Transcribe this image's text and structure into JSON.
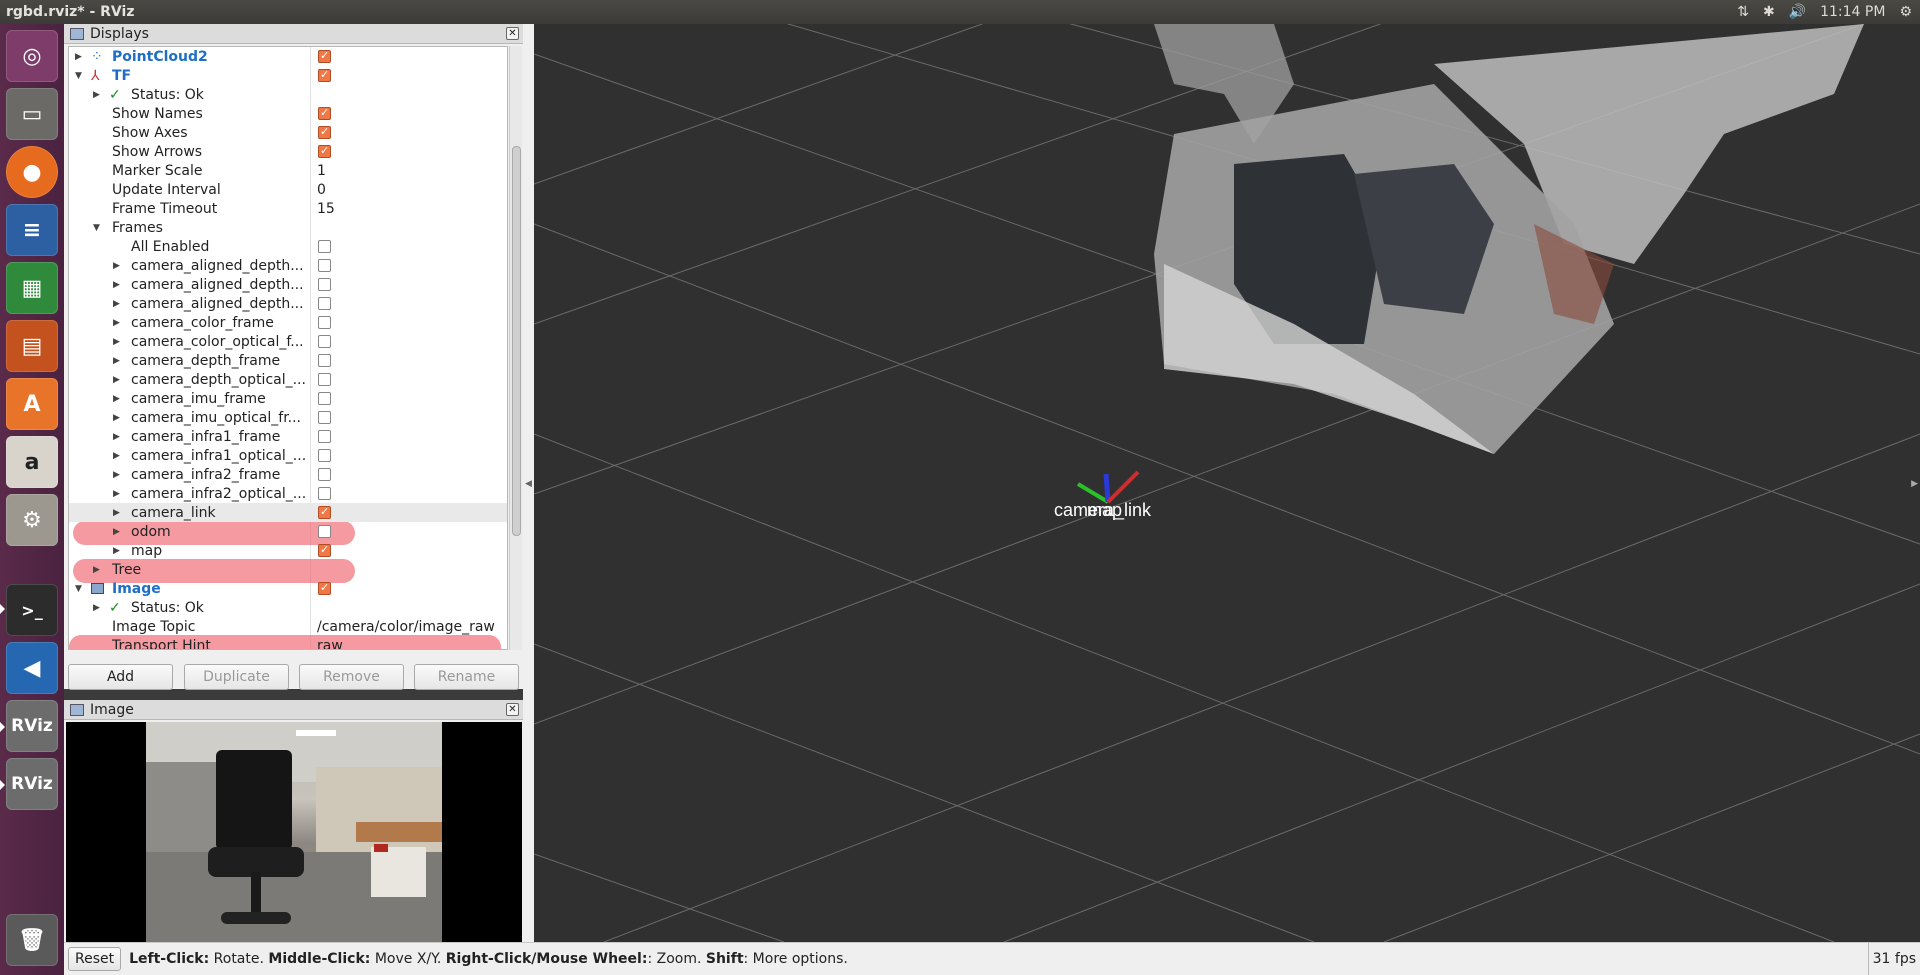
{
  "window": {
    "title": "rgbd.rviz* - RViz"
  },
  "indicators": {
    "time": "11:14 PM"
  },
  "displays_panel": {
    "title": "Displays",
    "rows": [
      {
        "label": "PointCloud2"
      },
      {
        "label": "TF"
      },
      {
        "label": "Status: Ok"
      },
      {
        "label": "Show Names"
      },
      {
        "label": "Show Axes"
      },
      {
        "label": "Show Arrows"
      },
      {
        "label": "Marker Scale",
        "value": "1"
      },
      {
        "label": "Update Interval",
        "value": "0"
      },
      {
        "label": "Frame Timeout",
        "value": "15"
      },
      {
        "label": "Frames"
      },
      {
        "label": "All Enabled"
      },
      {
        "label": "camera_aligned_depth..."
      },
      {
        "label": "camera_aligned_depth..."
      },
      {
        "label": "camera_aligned_depth..."
      },
      {
        "label": "camera_color_frame"
      },
      {
        "label": "camera_color_optical_f..."
      },
      {
        "label": "camera_depth_frame"
      },
      {
        "label": "camera_depth_optical_..."
      },
      {
        "label": "camera_imu_frame"
      },
      {
        "label": "camera_imu_optical_fr..."
      },
      {
        "label": "camera_infra1_frame"
      },
      {
        "label": "camera_infra1_optical_..."
      },
      {
        "label": "camera_infra2_frame"
      },
      {
        "label": "camera_infra2_optical_..."
      },
      {
        "label": "camera_link"
      },
      {
        "label": "odom"
      },
      {
        "label": "map"
      },
      {
        "label": "Tree"
      },
      {
        "label": "Image"
      },
      {
        "label": "Status: Ok"
      },
      {
        "label": "Image Topic",
        "value": "/camera/color/image_raw"
      },
      {
        "label": "Transport Hint",
        "value": "raw"
      }
    ],
    "buttons": {
      "add": "Add",
      "duplicate": "Duplicate",
      "remove": "Remove",
      "rename": "Rename"
    }
  },
  "image_panel": {
    "title": "Image"
  },
  "viewport": {
    "frame_label_1": "camera_link",
    "frame_label_2": "map"
  },
  "statusbar": {
    "reset": "Reset",
    "left_click": "Left-Click:",
    "left_click_desc": "Rotate.",
    "middle_click": "Middle-Click:",
    "middle_click_desc": "Move X/Y.",
    "right_click": "Right-Click/Mouse Wheel:",
    "right_click_desc": ": Zoom.",
    "shift": "Shift",
    "shift_desc": ": More options.",
    "fps": "31 fps"
  },
  "colors": {
    "accent": "#f07746",
    "highlight": "#f0646e",
    "link_blue": "#1e6fc4",
    "launcher": "#5a2a4a"
  }
}
